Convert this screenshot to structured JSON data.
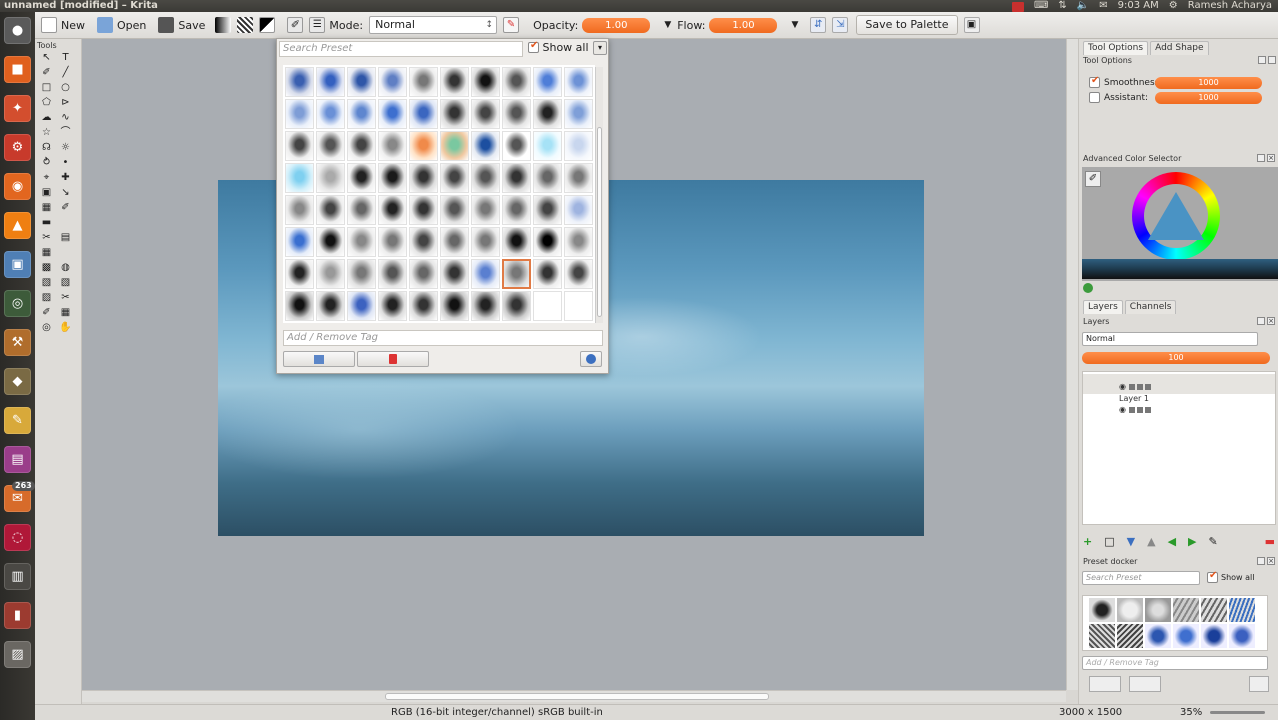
{
  "system_panel": {
    "window_title": "unnamed [modified] – Krita",
    "time": "9:03 AM",
    "user": "Ramesh Acharya"
  },
  "launcher": {
    "items": [
      {
        "name": "dash-home",
        "color": "#5a5a5a",
        "glyph": "●"
      },
      {
        "name": "files",
        "color": "#e0601e",
        "glyph": "■"
      },
      {
        "name": "app-center",
        "color": "#d34e2e",
        "glyph": "✦"
      },
      {
        "name": "settings",
        "color": "#c83a2b",
        "glyph": "⚙"
      },
      {
        "name": "firefox",
        "color": "#e2661f",
        "glyph": "◉"
      },
      {
        "name": "vlc",
        "color": "#ef7f12",
        "glyph": "▲"
      },
      {
        "name": "screenshot",
        "color": "#4f7fb5",
        "glyph": "▣"
      },
      {
        "name": "eye-app",
        "color": "#3d5b3a",
        "glyph": "◎"
      },
      {
        "name": "wine",
        "color": "#b06d2c",
        "glyph": "⚒"
      },
      {
        "name": "gimp",
        "color": "#7a6a44",
        "glyph": "◆"
      },
      {
        "name": "krita",
        "color": "#d8a93a",
        "glyph": "✎"
      },
      {
        "name": "kdenlive",
        "color": "#9a3d8a",
        "glyph": "▤"
      },
      {
        "name": "messages",
        "color": "#d76b2a",
        "glyph": "✉",
        "badge": "263"
      },
      {
        "name": "debian",
        "color": "#b01838",
        "glyph": "◌"
      },
      {
        "name": "terminal",
        "color": "#4a4844",
        "glyph": "▥"
      },
      {
        "name": "usb",
        "color": "#9c3b30",
        "glyph": "▮"
      },
      {
        "name": "trash",
        "color": "#6a6762",
        "glyph": "▨"
      }
    ]
  },
  "toolbar": {
    "new_label": "New",
    "open_label": "Open",
    "save_label": "Save",
    "mode_label": "Mode:",
    "mode_value": "Normal",
    "opacity_label": "Opacity:",
    "opacity_value": "1.00",
    "flow_label": "Flow:",
    "flow_value": "1.00",
    "save_palette_label": "Save to Palette"
  },
  "tools_docker": {
    "title": "Tools",
    "tools": [
      "↖",
      "T",
      "✐",
      "╱",
      "□",
      "○",
      "⬠",
      "⊳",
      "☁",
      "∿",
      "☆",
      "⌒",
      "☊",
      "☼",
      "⥁",
      "•",
      "⌖",
      "✚",
      "▣",
      "↘",
      "▦",
      "✐",
      "▬",
      "",
      "✂",
      "▤",
      "▦",
      "",
      "▩",
      "◍",
      "▧",
      "▧",
      "▨",
      "✂",
      "✐",
      "▦",
      "◎",
      "✋"
    ]
  },
  "preset_popup": {
    "search_placeholder": "Search Preset",
    "show_all_label": "Show all",
    "add_remove_tag_placeholder": "Add / Remove Tag",
    "brushes": [
      {
        "c1": "#3a5fb0",
        "c2": "#d8ddeb"
      },
      {
        "c1": "#3460c0",
        "c2": "#dfe4f3"
      },
      {
        "c1": "#2f56a8",
        "c2": "#e7eaf3"
      },
      {
        "c1": "#5f7fc4",
        "c2": "#eef0f6"
      },
      {
        "c1": "#777",
        "c2": "#eee"
      },
      {
        "c1": "#333",
        "c2": "#e8e8e8"
      },
      {
        "c1": "#111",
        "c2": "#ddd"
      },
      {
        "c1": "#555",
        "c2": "#e4e4e4"
      },
      {
        "c1": "#4f7ed8",
        "c2": "#e8eef9"
      },
      {
        "c1": "#6d92d6",
        "c2": "#eef2fa"
      },
      {
        "c1": "#7e9dd6",
        "c2": "#eaf0fa"
      },
      {
        "c1": "#6a90d7",
        "c2": "#edf2fb"
      },
      {
        "c1": "#5e86cf",
        "c2": "#eef2fa"
      },
      {
        "c1": "#3d6fcf",
        "c2": "#e8eef9"
      },
      {
        "c1": "#3b66c0",
        "c2": "#dfe6f5"
      },
      {
        "c1": "#333",
        "c2": "#ddd"
      },
      {
        "c1": "#444",
        "c2": "#e6e6e6"
      },
      {
        "c1": "#555",
        "c2": "#e6e6e6"
      },
      {
        "c1": "#222",
        "c2": "#e2e2e2"
      },
      {
        "c1": "#7f9fd8",
        "c2": "#eaf0fa"
      },
      {
        "c1": "#444",
        "c2": "#eee"
      },
      {
        "c1": "#555",
        "c2": "#eee"
      },
      {
        "c1": "#444",
        "c2": "#eee"
      },
      {
        "c1": "#888",
        "c2": "#f0f0f0"
      },
      {
        "c1": "#f08a4a",
        "c2": "#ffe2c6"
      },
      {
        "c1": "#7ac8a0",
        "c2": "#f0c8a0"
      },
      {
        "c1": "#1c4fa0",
        "c2": "#e6ebf3"
      },
      {
        "c1": "#555",
        "c2": "#fff"
      },
      {
        "c1": "#a6e2f6",
        "c2": "#f0fbff"
      },
      {
        "c1": "#c8d6ee",
        "c2": "#f4f7fc"
      },
      {
        "c1": "#7fd0f0",
        "c2": "#d4f0fa"
      },
      {
        "c1": "#aaa",
        "c2": "#e8e8e8"
      },
      {
        "c1": "#222",
        "c2": "#f0f0f0"
      },
      {
        "c1": "#1a1a1a",
        "c2": "#e6e6e6"
      },
      {
        "c1": "#333",
        "c2": "#ddd"
      },
      {
        "c1": "#444",
        "c2": "#e4e4e4"
      },
      {
        "c1": "#555",
        "c2": "#ddd"
      },
      {
        "c1": "#333",
        "c2": "#ddd"
      },
      {
        "c1": "#666",
        "c2": "#e4e4e4"
      },
      {
        "c1": "#777",
        "c2": "#eaeaea"
      },
      {
        "c1": "#888",
        "c2": "#eaeaea"
      },
      {
        "c1": "#444",
        "c2": "#eee"
      },
      {
        "c1": "#666",
        "c2": "#eee"
      },
      {
        "c1": "#222",
        "c2": "#eee"
      },
      {
        "c1": "#333",
        "c2": "#e8e8e8"
      },
      {
        "c1": "#555",
        "c2": "#e2e2e2"
      },
      {
        "c1": "#777",
        "c2": "#e8e8e8"
      },
      {
        "c1": "#666",
        "c2": "#e6e6e6"
      },
      {
        "c1": "#444",
        "c2": "#e2e2e2"
      },
      {
        "c1": "#9fb4e0",
        "c2": "#eef2fa"
      },
      {
        "c1": "#3a6fd0",
        "c2": "#e6edf9"
      },
      {
        "c1": "#111",
        "c2": "#eee"
      },
      {
        "c1": "#888",
        "c2": "#eee"
      },
      {
        "c1": "#777",
        "c2": "#eee"
      },
      {
        "c1": "#444",
        "c2": "#e6e6e6"
      },
      {
        "c1": "#666",
        "c2": "#eaeaea"
      },
      {
        "c1": "#777",
        "c2": "#eaeaea"
      },
      {
        "c1": "#111",
        "c2": "#ddd"
      },
      {
        "c1": "#000",
        "c2": "#eee"
      },
      {
        "c1": "#888",
        "c2": "#eee"
      },
      {
        "c1": "#222",
        "c2": "#eee"
      },
      {
        "c1": "#999",
        "c2": "#eaeaea"
      },
      {
        "c1": "#777",
        "c2": "#e2e2e2"
      },
      {
        "c1": "#555",
        "c2": "#e4e4e4"
      },
      {
        "c1": "#666",
        "c2": "#e6e6e6"
      },
      {
        "c1": "#333",
        "c2": "#e2e2e2"
      },
      {
        "c1": "#5a7fd0",
        "c2": "#e6ecf8"
      },
      {
        "c1": "#777",
        "c2": "#dcdcdc",
        "selected": true
      },
      {
        "c1": "#333",
        "c2": "#eee"
      },
      {
        "c1": "#444",
        "c2": "#eee"
      },
      {
        "c1": "#111",
        "c2": "#ccc"
      },
      {
        "c1": "#222",
        "c2": "#ddd"
      },
      {
        "c1": "#3c62c0",
        "c2": "#dfe6f5"
      },
      {
        "c1": "#222",
        "c2": "#ddd"
      },
      {
        "c1": "#333",
        "c2": "#ddd"
      },
      {
        "c1": "#111",
        "c2": "#ccc"
      },
      {
        "c1": "#222",
        "c2": "#ccc"
      },
      {
        "c1": "#333",
        "c2": "#ccc"
      },
      {
        "c1": "#fff",
        "c2": "#fff"
      },
      {
        "c1": "#fff",
        "c2": "#fff"
      }
    ]
  },
  "right_docker": {
    "tabs": [
      "Tool Options",
      "Add Shape"
    ],
    "tool_options_title": "Tool Options",
    "smoothness_label": "Smoothness:",
    "smoothness_value": "1000",
    "assistant_label": "Assistant:",
    "assistant_value": "1000",
    "color_selector_title": "Advanced Color Selector",
    "layers_tabs": [
      "Layers",
      "Channels"
    ],
    "layers_title": "Layers",
    "blend_mode": "Normal",
    "layer_opacity": "100",
    "layers": [
      "Layer 1"
    ],
    "preset_docker_title": "Preset docker",
    "preset_search_placeholder": "Search Preset",
    "preset_show_all": "Show all",
    "preset_tag_placeholder": "Add / Remove Tag"
  },
  "status_bar": {
    "color_info": "RGB (16-bit integer/channel)  sRGB built-in",
    "image_size": "3000 x 1500",
    "zoom": "35%"
  }
}
